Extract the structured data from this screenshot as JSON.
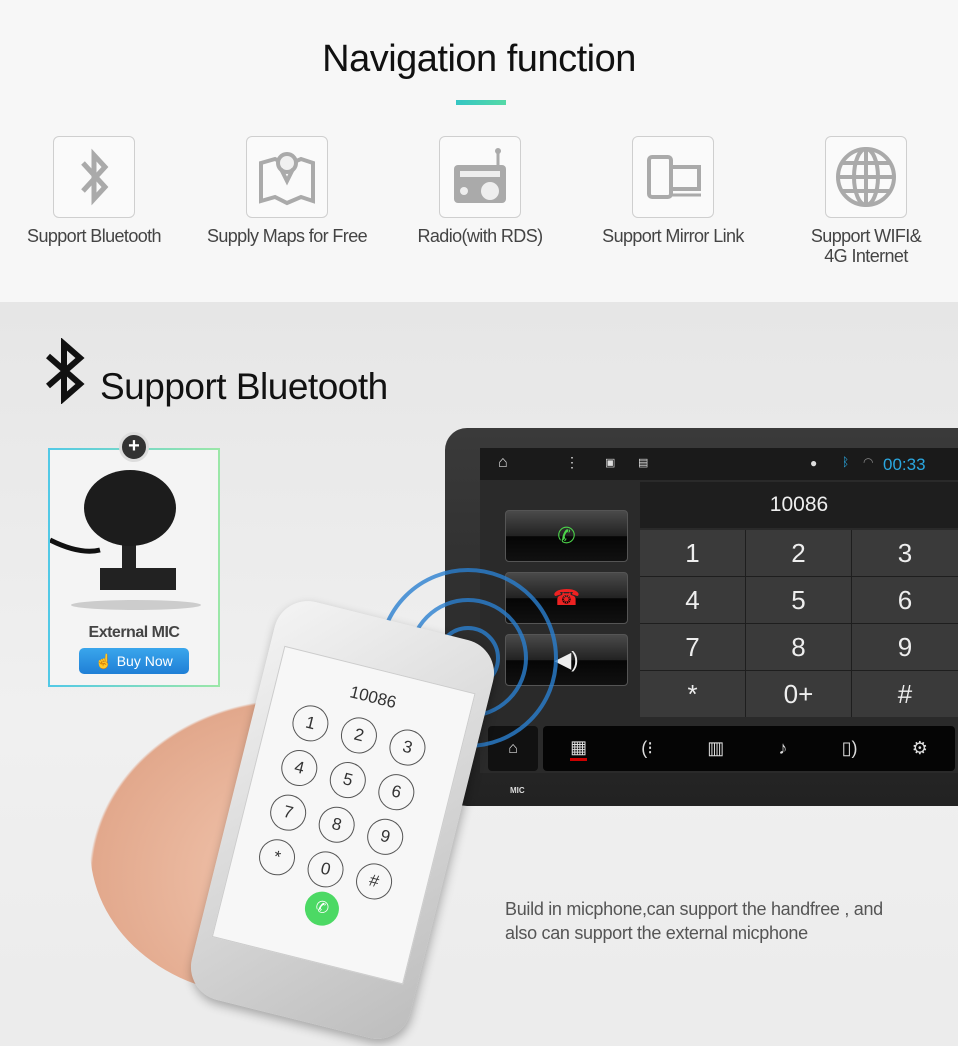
{
  "header": {
    "title": "Navigation function",
    "accent": "#3fcdb8"
  },
  "features": [
    {
      "icon": "bluetooth-icon",
      "label": "Support Bluetooth"
    },
    {
      "icon": "map-icon",
      "label": "Supply Maps for Free"
    },
    {
      "icon": "radio-icon",
      "label": "Radio(with RDS)"
    },
    {
      "icon": "mirror-link-icon",
      "label": "Support Mirror Link"
    },
    {
      "icon": "globe-icon",
      "label": "Support  WIFI& 4G Internet"
    }
  ],
  "bluetooth": {
    "title": "Support Bluetooth"
  },
  "mic_card": {
    "label": "External MIC",
    "buy": "Buy Now",
    "plus": "+"
  },
  "head_unit": {
    "clock": "00:33",
    "number": "10086",
    "keys": [
      "1",
      "2",
      "3",
      "4",
      "5",
      "6",
      "7",
      "8",
      "9",
      "*",
      "0+",
      "#"
    ],
    "mic_label": "MIC",
    "clock_color": "#2aa7e0"
  },
  "phone": {
    "number": "10086",
    "keys": [
      "1",
      "2",
      "3",
      "4",
      "5",
      "6",
      "7",
      "8",
      "9",
      "*",
      "0",
      "#"
    ]
  },
  "caption": {
    "line1": "Build in micphone,can support the handfree , and",
    "line2": "also can support the external micphone"
  }
}
